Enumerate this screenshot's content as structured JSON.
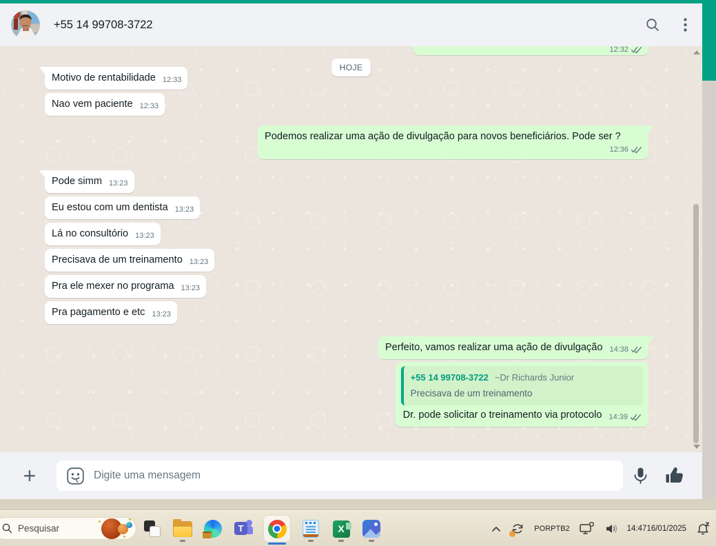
{
  "colors": {
    "accent": "#00a285",
    "outgoing_bubble": "#d9fdd3",
    "incoming_bubble": "#ffffff",
    "quote_accent": "#00a884",
    "header_bg": "#f0f2f5",
    "chat_bg": "#ece5dd",
    "chrome_active_underline": "#2e7ad7"
  },
  "header": {
    "title": "+55 14 99708-3722",
    "icons": [
      "search-icon",
      "kebab-menu-icon"
    ]
  },
  "chat": {
    "date_pill": "HOJE",
    "cut_message": {
      "side": "right",
      "time": "12:32"
    },
    "messages": [
      {
        "side": "left",
        "text": "Motivo de rentabilidade",
        "time": "12:33"
      },
      {
        "side": "left",
        "text": "Nao vem paciente",
        "time": "12:33"
      },
      {
        "side": "right",
        "text": "Podemos realizar uma ação de divulgação para novos beneficiários. Pode ser ?",
        "time": "12:36"
      },
      {
        "side": "left",
        "text": "Pode simm",
        "time": "13:23"
      },
      {
        "side": "left",
        "text": "Eu estou com um dentista",
        "time": "13:23"
      },
      {
        "side": "left",
        "text": "Lá no consultório",
        "time": "13:23"
      },
      {
        "side": "left",
        "text": "Precisava de um treinamento",
        "time": "13:23"
      },
      {
        "side": "left",
        "text": "Pra ele mexer no programa",
        "time": "13:23"
      },
      {
        "side": "left",
        "text": "Pra pagamento e etc",
        "time": "13:23"
      },
      {
        "side": "right",
        "text": "Perfeito, vamos realizar uma ação de divulgação",
        "time": "14:38"
      },
      {
        "side": "right",
        "time": "14:39",
        "quote": {
          "author_phone": "+55 14 99708-3722",
          "author_name": "~Dr Richards Junior",
          "text": "Precisava de um treinamento"
        },
        "text": "Dr. pode solicitar o treinamento via protocolo"
      }
    ]
  },
  "composer": {
    "placeholder": "Digite uma mensagem",
    "icons": [
      "plus-icon",
      "sticker-emoji-icon",
      "microphone-icon",
      "thumbs-up-icon"
    ]
  },
  "taskbar": {
    "search_placeholder": "Pesquisar",
    "apps": [
      "task-view",
      "file-explorer",
      "edge",
      "teams",
      "chrome",
      "notepad",
      "excel",
      "photos"
    ],
    "active_app": "chrome",
    "tray": {
      "language_top": "POR",
      "language_bottom": "PTB2",
      "time": "14:47",
      "date": "16/01/2025",
      "icons": [
        "tray-chevron-icon",
        "sync-icon",
        "network-display-icon",
        "speaker-icon",
        "focus-bell-icon"
      ]
    }
  }
}
